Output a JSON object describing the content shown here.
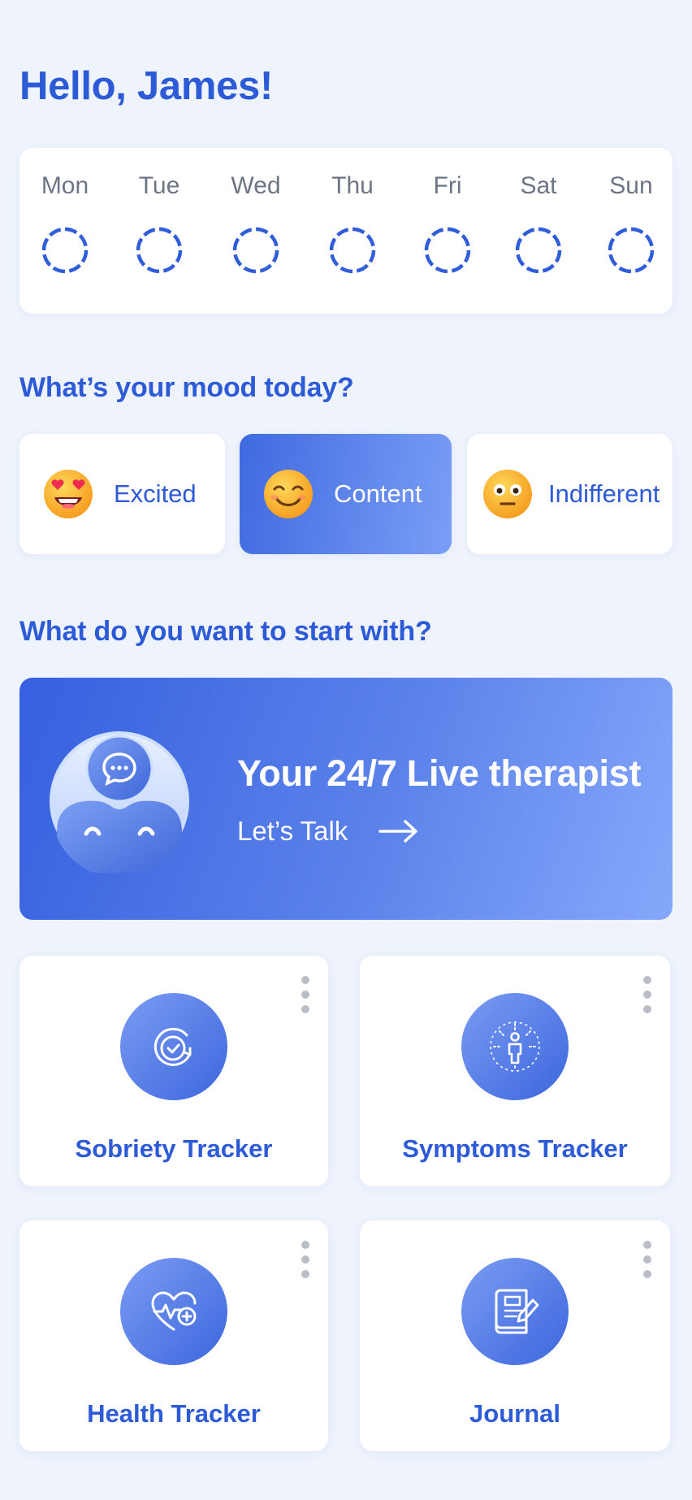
{
  "greeting": "Hello, James!",
  "week": {
    "days": [
      "Mon",
      "Tue",
      "Wed",
      "Thu",
      "Fri",
      "Sat",
      "Sun"
    ]
  },
  "mood_section": {
    "title": "What’s your mood today?",
    "options": [
      {
        "label": "Excited",
        "emoji": "star-struck-emoji",
        "selected": false
      },
      {
        "label": "Content",
        "emoji": "smiling-face-emoji",
        "selected": true
      },
      {
        "label": "Indifferent",
        "emoji": "neutral-face-emoji",
        "selected": false
      }
    ]
  },
  "start_section": {
    "title": "What do you want to start with?"
  },
  "therapist_banner": {
    "title": "Your 24/7 Live therapist",
    "cta": "Let’s Talk",
    "icon": "chat-bot-avatar-icon"
  },
  "tiles": [
    {
      "label": "Sobriety Tracker",
      "icon": "sobriety-check-icon"
    },
    {
      "label": "Symptoms Tracker",
      "icon": "symptoms-body-icon"
    },
    {
      "label": "Health Tracker",
      "icon": "heart-pulse-icon"
    },
    {
      "label": "Journal",
      "icon": "journal-pen-icon"
    }
  ],
  "colors": {
    "accent": "#2d5bd7",
    "background": "#eef3fc",
    "gradient_start": "#3560df",
    "gradient_end": "#86a8fb"
  }
}
